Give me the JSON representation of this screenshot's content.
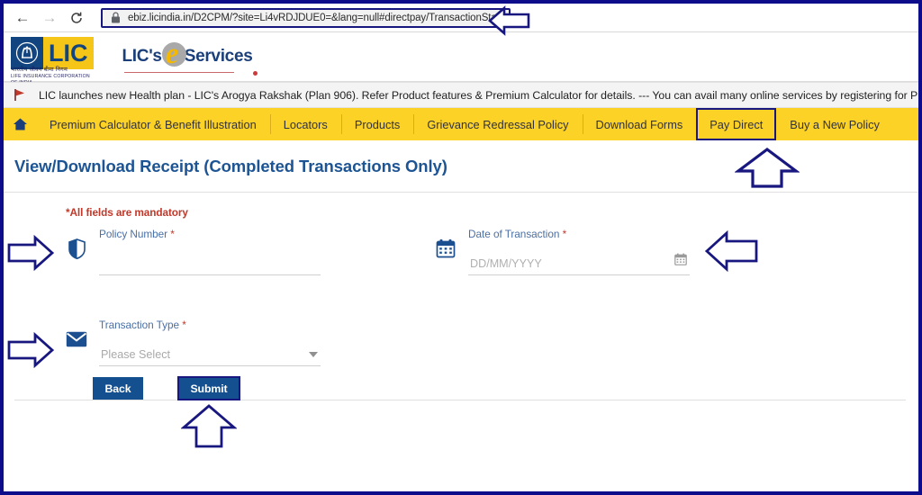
{
  "browser": {
    "back_icon": "arrow-left-icon",
    "forward_icon": "arrow-right-icon",
    "reload_icon": "reload-icon",
    "lock_icon": "lock-icon",
    "url_host": "ebiz.licindia.in",
    "url_path": "/D2CPM/?site=Li4vRDJDUE0=&lang=null#directpay/TransactionStatus",
    "url_full": "ebiz.licindia.in/D2CPM/?site=Li4vRDJDUE0=&lang=null#directpay/TransactionStatus"
  },
  "header": {
    "logo_word": "LIC",
    "logo_emblem": "lic-hands-emblem",
    "logo_sub_hindi": "भारतीय जीवन बीमा निगम",
    "logo_sub_english": "LIFE INSURANCE CORPORATION OF INDIA",
    "eservices_prefix": "LIC's",
    "eservices_e": "e",
    "eservices_suffix": "Services"
  },
  "ticker": {
    "flag_icon": "red-flag-icon",
    "text": "LIC launches new Health plan - LIC's Arogya Rakshak (Plan 906).   Refer Product features & Premium Calculator for details.  ---  You can avail many online services by registering for Pr"
  },
  "nav": {
    "home_icon": "home-icon",
    "items": [
      {
        "label": "Premium Calculator & Benefit Illustration",
        "active": false
      },
      {
        "label": "Locators",
        "active": false
      },
      {
        "label": "Products",
        "active": false
      },
      {
        "label": "Grievance Redressal Policy",
        "active": false
      },
      {
        "label": "Download Forms",
        "active": false
      },
      {
        "label": "Pay Direct",
        "active": true
      },
      {
        "label": "Buy a New Policy",
        "active": false
      }
    ]
  },
  "page": {
    "title": "View/Download Receipt (Completed Transactions Only)",
    "mandatory_note": "*All fields are mandatory"
  },
  "form": {
    "policy_number": {
      "icon": "shield-icon",
      "label": "Policy Number",
      "required_mark": "*",
      "value": "",
      "placeholder": ""
    },
    "date_of_transaction": {
      "icon": "calendar-icon",
      "label": "Date of Transaction",
      "required_mark": "*",
      "value": "",
      "placeholder": "DD/MM/YYYY",
      "picker_icon": "calendar-picker-icon"
    },
    "transaction_type": {
      "icon": "envelope-icon",
      "label": "Transaction Type",
      "required_mark": "*",
      "selected": "Please Select",
      "caret_icon": "chevron-down-icon"
    }
  },
  "buttons": {
    "back": "Back",
    "submit": "Submit"
  },
  "annotations": {
    "url_arrow": "arrow-left-annotation",
    "paydirect_arrow": "arrow-up-annotation",
    "policy_arrow": "arrow-right-annotation",
    "date_arrow": "arrow-left-annotation",
    "transaction_arrow": "arrow-right-annotation",
    "submit_arrow": "arrow-up-annotation"
  },
  "colors": {
    "frame": "#0d0d8c",
    "nav_gold": "#fcd227",
    "title_blue": "#1d5494",
    "button_blue": "#14508f",
    "required_red": "#c0392b",
    "annotation": "#17177f"
  }
}
